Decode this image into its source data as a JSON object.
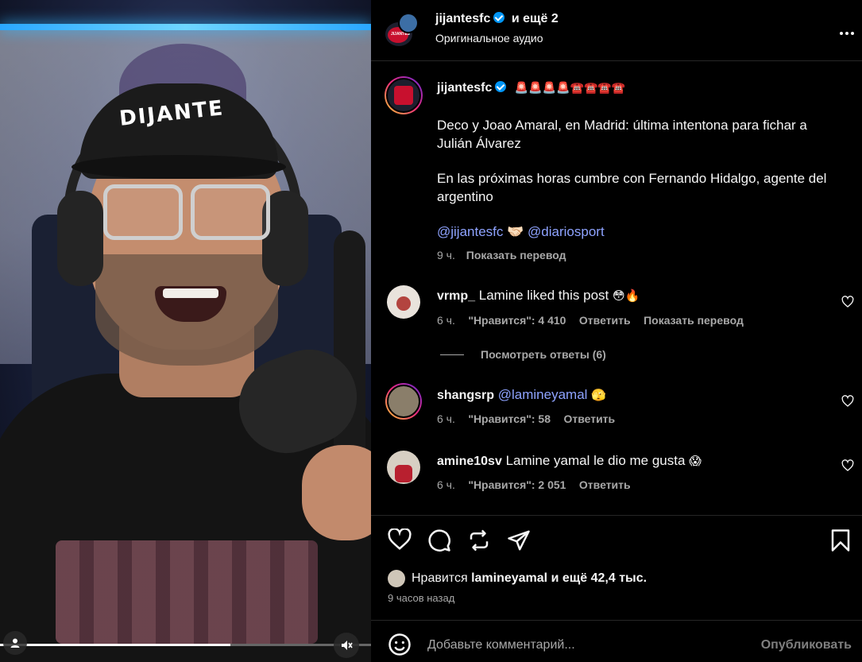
{
  "video": {
    "cap_text": "DIJANTE",
    "progress": 0.62
  },
  "header": {
    "username": "jijantesfc",
    "and_more": "и ещё 2",
    "audio": "Оригинальное аудио",
    "avatar_logo": "JIJANTES"
  },
  "post": {
    "username": "jijantesfc",
    "emoji_line": "🚨🚨🚨🚨☎️☎️☎️☎️",
    "caption_1": "Deco y Joao Amaral, en Madrid: última intentona para fichar a Julián Álvarez",
    "caption_2": "En las próximas horas cumbre con Fernando Hidalgo, agente del argentino",
    "mention_1": "@jijantesfc",
    "mention_sep": "🤝🏻",
    "mention_2": "@diariosport",
    "time": "9 ч.",
    "translate": "Показать перевод"
  },
  "comments": [
    {
      "username": "vrmp_",
      "text": "Lamine liked this post",
      "emoji": "😳🔥",
      "time": "6 ч.",
      "likes": "\"Нравится\": 4 410",
      "reply": "Ответить",
      "translate": "Показать перевод"
    },
    {
      "username": "shangsrp",
      "mention": "@lamineyamal",
      "emoji": "🫣",
      "time": "6 ч.",
      "likes": "\"Нравится\": 58",
      "reply": "Ответить"
    },
    {
      "username": "amine10sv",
      "text": "Lamine yamal le dio me gusta",
      "emoji": "😱",
      "time": "6 ч.",
      "likes": "\"Нравится\": 2 051",
      "reply": "Ответить"
    }
  ],
  "view_replies": "Посмотреть ответы (6)",
  "likes_summary": {
    "prefix": "Нравится",
    "user": "lamineyamal",
    "suffix": "и ещё 42,4 тыс."
  },
  "posted_ago": "9 часов назад",
  "comment_box": {
    "placeholder": "Добавьте комментарий...",
    "publish": "Опубликовать"
  },
  "icons": {
    "more": "more-icon",
    "like": "heart-icon",
    "comment": "comment-icon",
    "repost": "repost-icon",
    "share": "share-icon",
    "save": "bookmark-icon",
    "emoji": "emoji-icon",
    "mute": "mute-icon",
    "user": "user-icon"
  },
  "colors": {
    "link": "#8ea3ff",
    "verified": "#0095f6",
    "text_muted": "#a8a8a8"
  }
}
